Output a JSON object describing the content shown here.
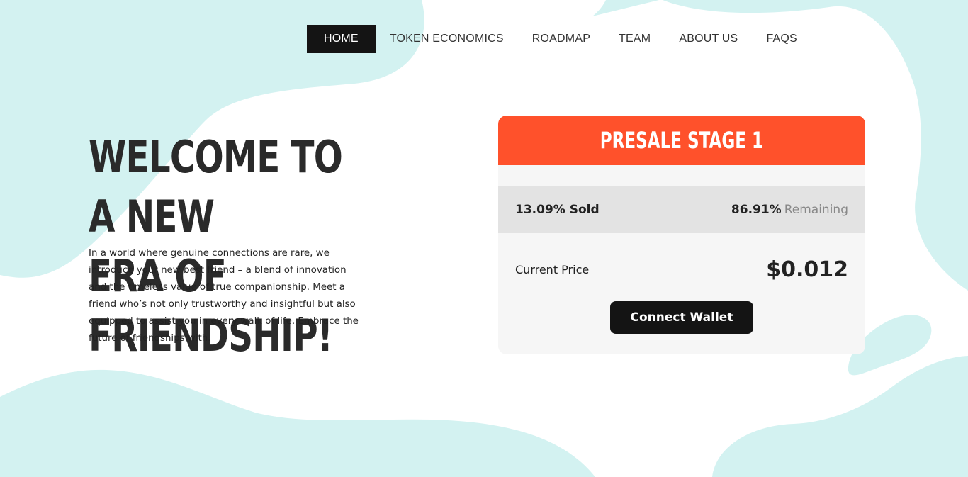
{
  "colors": {
    "blob": "#d3f2f1",
    "accent": "#ff512b",
    "dark": "#141414",
    "card_bg": "#f6f6f6",
    "progress_bg": "#e3e3e3"
  },
  "nav": {
    "items": [
      {
        "label": "HOME",
        "active": true
      },
      {
        "label": "TOKEN ECONOMICS",
        "active": false
      },
      {
        "label": "ROADMAP",
        "active": false
      },
      {
        "label": "TEAM",
        "active": false
      },
      {
        "label": "ABOUT US",
        "active": false
      },
      {
        "label": "FAQS",
        "active": false
      }
    ]
  },
  "hero": {
    "title_line1": "WELCOME TO A NEW",
    "title_line2": "ERA OF FRIENDSHIP!",
    "description": "In a world where genuine connections are rare, we introduce your new best friend – a blend of innovation and the timeless value of true companionship. Meet a friend who’s not only trustworthy and insightful but also equipped to assist you in every walk of life. Embrace the future of friendships with."
  },
  "presale": {
    "title": "PRESALE STAGE 1",
    "sold_percent": "13.09%",
    "sold_label": "Sold",
    "remaining_percent": "86.91%",
    "remaining_label": "Remaining",
    "price_label": "Current Price",
    "price_value": "$0.012",
    "connect_label": "Connect Wallet"
  }
}
